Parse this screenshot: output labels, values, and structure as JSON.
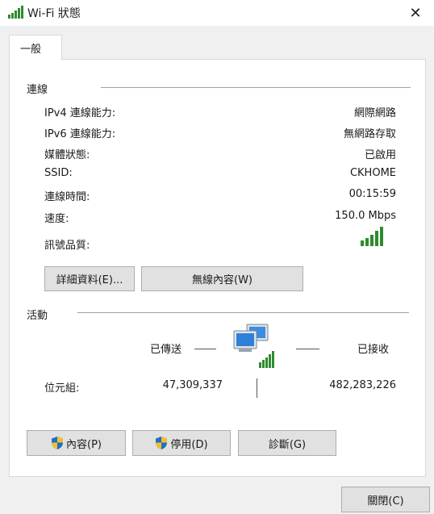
{
  "window": {
    "title": "Wi-Fi 狀態",
    "close_glyph": "✕"
  },
  "tab": {
    "label": "一般"
  },
  "connection": {
    "title": "連線",
    "rows": [
      {
        "label": "IPv4 連線能力:",
        "value": "網際網路"
      },
      {
        "label": "IPv6 連線能力:",
        "value": "無網路存取"
      },
      {
        "label": "媒體狀態:",
        "value": "已啟用"
      },
      {
        "label": "SSID:",
        "value": "CKHOME"
      },
      {
        "label": "連線時間:",
        "value": "00:15:59"
      },
      {
        "label": "速度:",
        "value": "150.0 Mbps"
      }
    ],
    "signal_label": "訊號品質:",
    "signal_bars": 5,
    "details_button": "詳細資料(E)...",
    "wireless_button": "無線內容(W)"
  },
  "activity": {
    "title": "活動",
    "sent_label": "已傳送",
    "received_label": "已接收",
    "bytes_label": "位元組:",
    "bytes_sent": "47,309,337",
    "bytes_received": "482,283,226"
  },
  "buttons": {
    "properties": "內容(P)",
    "disable": "停用(D)",
    "diagnose": "診斷(G)",
    "close": "關閉(C)"
  },
  "colors": {
    "signal_green": "#2e8b2e",
    "accent_blue": "#1f6fc9"
  },
  "icons": {
    "title": "wifi-signal-icon",
    "network": "network-computers-icon",
    "shield": "uac-shield-icon"
  }
}
